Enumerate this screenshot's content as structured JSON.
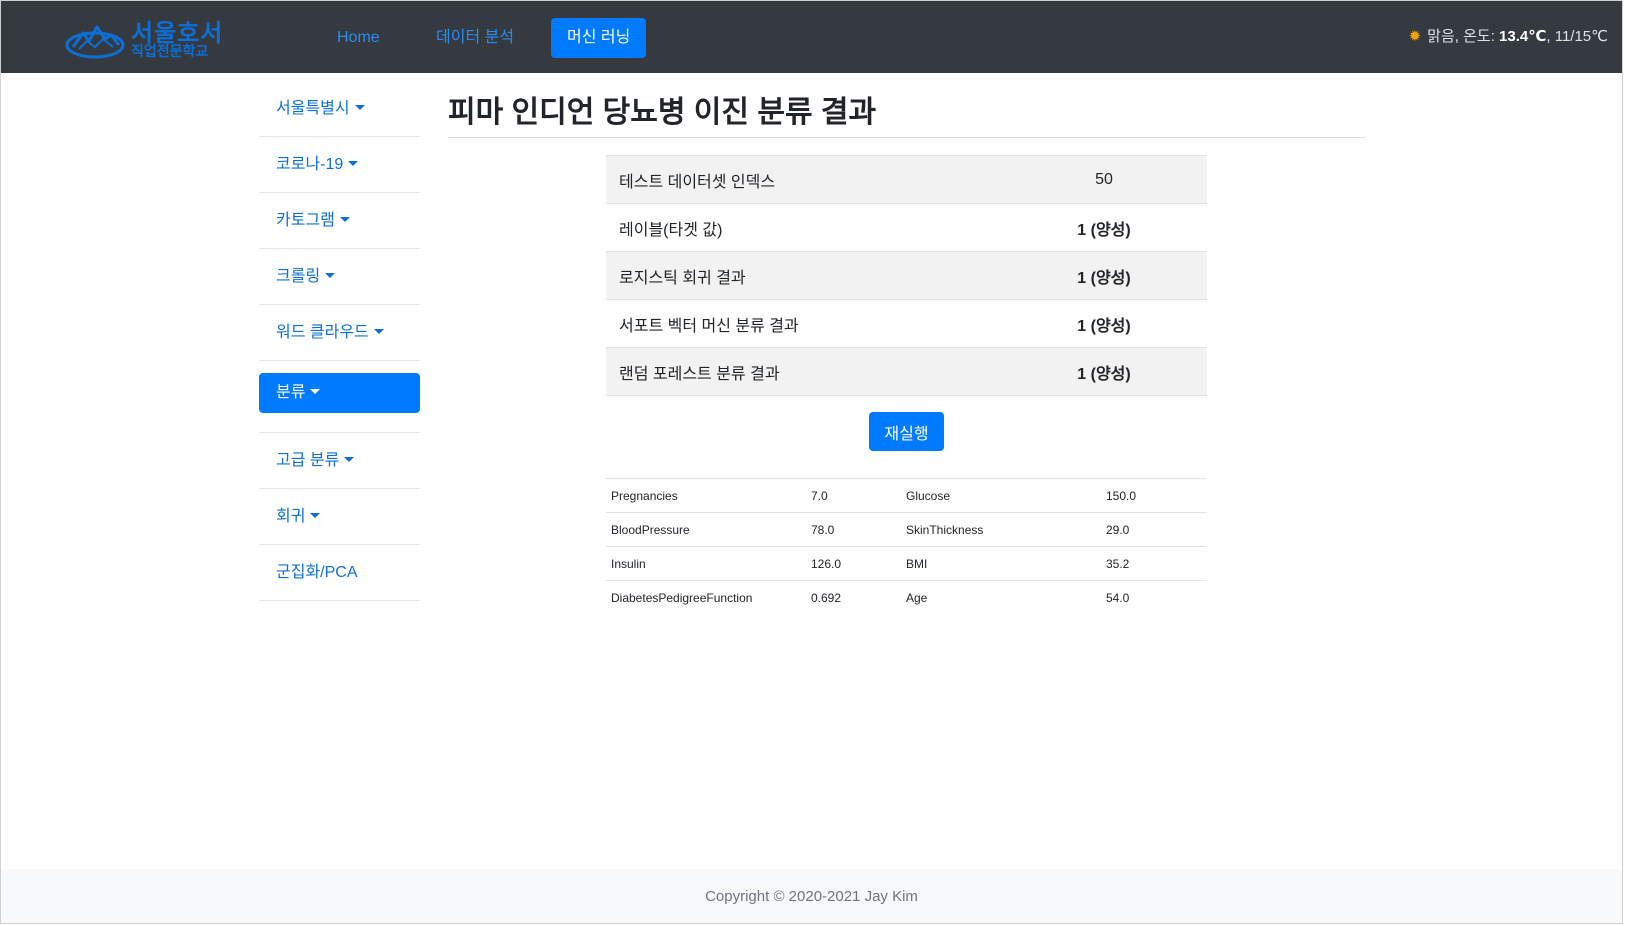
{
  "brand": {
    "line1": "서울호서",
    "line2": "직업전문학교"
  },
  "nav": {
    "home": "Home",
    "data_analysis": "데이터 분석",
    "machine_learning": "머신 러닝"
  },
  "weather": {
    "icon": "sun-icon",
    "prefix": "맑음, 온도: ",
    "temp": "13.4℃",
    "range": ", 11/15℃"
  },
  "sidebar": {
    "items": [
      {
        "label": "서울특별시",
        "dropdown": true
      },
      {
        "label": "코로나-19",
        "dropdown": true
      },
      {
        "label": "카토그램",
        "dropdown": true
      },
      {
        "label": "크롤링",
        "dropdown": true
      },
      {
        "label": "워드 클라우드",
        "dropdown": true
      },
      {
        "label": "분류",
        "dropdown": true,
        "active": true
      },
      {
        "label": "고급 분류",
        "dropdown": true
      },
      {
        "label": "회귀",
        "dropdown": true
      },
      {
        "label": "군집화/PCA",
        "dropdown": false
      }
    ]
  },
  "main": {
    "title": "피마 인디언 당뇨병 이진 분류 결과",
    "results": [
      {
        "label": "테스트 데이터셋 인덱스",
        "value": "50"
      },
      {
        "label": "레이블(타겟 값)",
        "value": "1 (양성)"
      },
      {
        "label": "로지스틱 회귀 결과",
        "value": "1 (양성)"
      },
      {
        "label": "서포트 벡터 머신 분류 결과",
        "value": "1 (양성)"
      },
      {
        "label": "랜덤 포레스트 분류 결과",
        "value": "1 (양성)"
      }
    ],
    "rerun_label": "재실행",
    "features": [
      {
        "name1": "Pregnancies",
        "val1": "7.0",
        "name2": "Glucose",
        "val2": "150.0"
      },
      {
        "name1": "BloodPressure",
        "val1": "78.0",
        "name2": "SkinThickness",
        "val2": "29.0"
      },
      {
        "name1": "Insulin",
        "val1": "126.0",
        "name2": "BMI",
        "val2": "35.2"
      },
      {
        "name1": "DiabetesPedigreeFunction",
        "val1": "0.692",
        "name2": "Age",
        "val2": "54.0"
      }
    ]
  },
  "footer": {
    "copyright": "Copyright © 2020-2021 Jay Kim"
  },
  "colors": {
    "navbar_bg": "#343a40",
    "accent": "#007bff",
    "link": "#0d6fd6",
    "footer_bg": "#f8f9fa"
  }
}
